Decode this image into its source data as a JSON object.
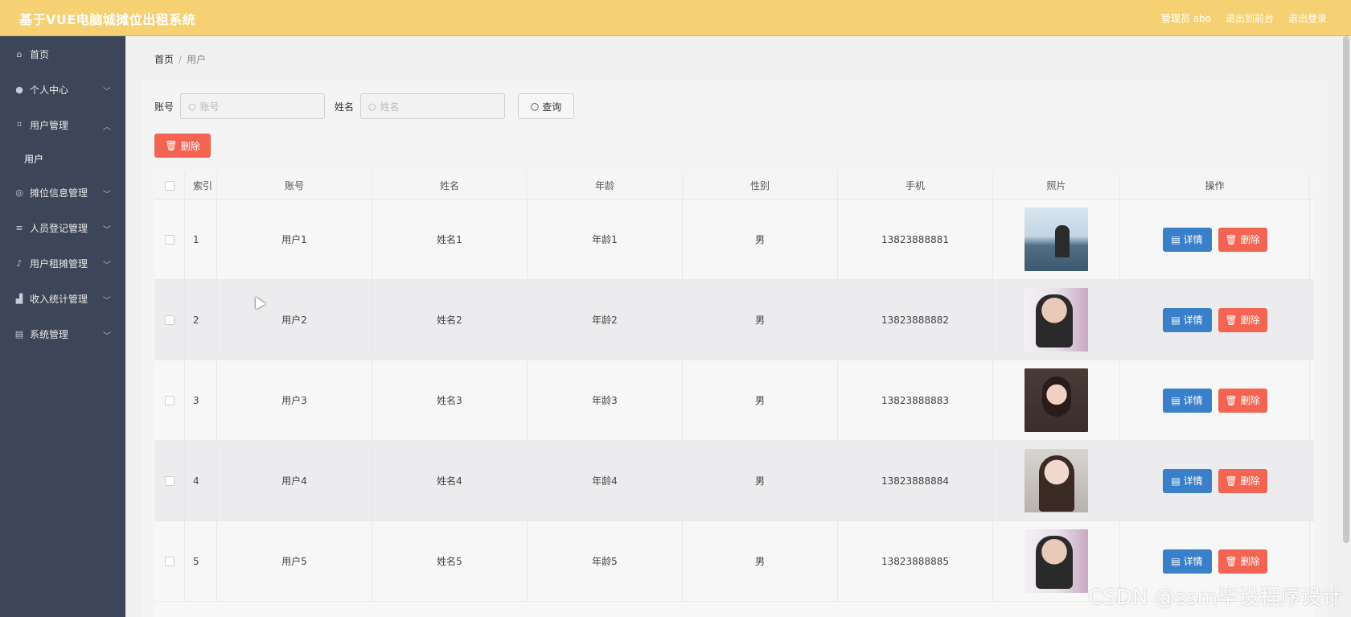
{
  "header": {
    "title": "基于VUE电脑城摊位出租系统",
    "admin": "管理员 abo",
    "to_front": "退出到前台",
    "logout": "退出登录"
  },
  "sidebar": {
    "items": [
      {
        "label": "首页",
        "icon": "home-icon"
      },
      {
        "label": "个人中心",
        "icon": "user-icon"
      },
      {
        "label": "用户管理",
        "icon": "crop-icon"
      },
      {
        "label": "摊位信息管理",
        "icon": "circle-icon"
      },
      {
        "label": "人员登记管理",
        "icon": "stack-icon"
      },
      {
        "label": "用户租摊管理",
        "icon": "mic-icon"
      },
      {
        "label": "收入统计管理",
        "icon": "chart-icon"
      },
      {
        "label": "系统管理",
        "icon": "doc-icon"
      }
    ],
    "subitem": "用户"
  },
  "breadcrumb": {
    "home": "首页",
    "sep": "/",
    "current": "用户"
  },
  "search": {
    "account_label": "账号",
    "account_placeholder": "账号",
    "name_label": "姓名",
    "name_placeholder": "姓名",
    "query_button": "查询"
  },
  "actions": {
    "delete_button": "删除"
  },
  "table": {
    "headers": [
      "",
      "索引",
      "账号",
      "姓名",
      "年龄",
      "性别",
      "手机",
      "照片",
      "操作"
    ],
    "rows": [
      {
        "index": "1",
        "account": "用户1",
        "name": "姓名1",
        "age": "年龄1",
        "gender": "男",
        "phone": "13823888881"
      },
      {
        "index": "2",
        "account": "用户2",
        "name": "姓名2",
        "age": "年龄2",
        "gender": "男",
        "phone": "13823888882"
      },
      {
        "index": "3",
        "account": "用户3",
        "name": "姓名3",
        "age": "年龄3",
        "gender": "男",
        "phone": "13823888883"
      },
      {
        "index": "4",
        "account": "用户4",
        "name": "姓名4",
        "age": "年龄4",
        "gender": "男",
        "phone": "13823888884"
      },
      {
        "index": "5",
        "account": "用户5",
        "name": "姓名5",
        "age": "年龄5",
        "gender": "男",
        "phone": "13823888885"
      }
    ],
    "detail_button": "详情",
    "row_delete_button": "删除"
  },
  "watermark": "CSDN @ssm毕设程序设计",
  "colors": {
    "topbar": "#f6d173",
    "sidebar": "#3d4658",
    "primary": "#3a7fc9",
    "danger": "#f36552"
  }
}
